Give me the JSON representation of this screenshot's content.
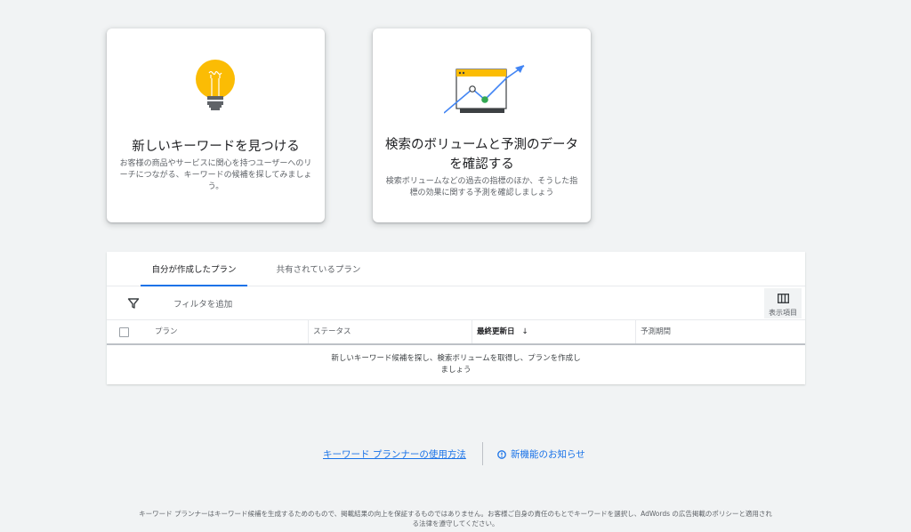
{
  "cards": [
    {
      "title": "新しいキーワードを見つける",
      "description": "お客様の商品やサービスに関心を持つユーザーへのリーチにつながる、キーワードの候補を探してみましょう。",
      "icon": "lightbulb-icon"
    },
    {
      "title": "検索のボリュームと予測のデータを確認する",
      "description": "検索ボリュームなどの過去の指標のほか、そうした指標の効果に関する予測を確認しましょう",
      "icon": "trend-chart-icon"
    }
  ],
  "tabs": [
    {
      "label": "自分が作成したプラン",
      "active": true
    },
    {
      "label": "共有されているプラン",
      "active": false
    }
  ],
  "filter": {
    "icon": "filter-icon",
    "label": "フィルタを追加"
  },
  "columns_button": {
    "icon": "columns-icon",
    "label": "表示項目"
  },
  "table": {
    "headers": [
      "プラン",
      "ステータス",
      "最終更新日",
      "予測期間"
    ],
    "sort_icon": "arrow-down-icon",
    "empty_message_line1": "新しいキーワード候補を探し、検索ボリュームを取得し、プランを作成し",
    "empty_message_line2": "ましょう"
  },
  "footer": {
    "howto_link": "キーワード プランナーの使用方法",
    "whatsnew_link": "新機能のお知らせ",
    "whatsnew_icon": "info-icon",
    "disclaimer_line1": "キーワード プランナーはキーワード候補を生成するためのもので、掲載結果の向上を保証するものではありません。お客様ご自身の責任のもとでキーワードを選択し、AdWords の広告掲載のポリシーと適用され",
    "disclaimer_line2": "る法律を遵守してください。"
  },
  "colors": {
    "accent": "#1a73e8",
    "bulb": "#fbbc04",
    "dot": "#34a853",
    "background": "#f1f3f4"
  }
}
